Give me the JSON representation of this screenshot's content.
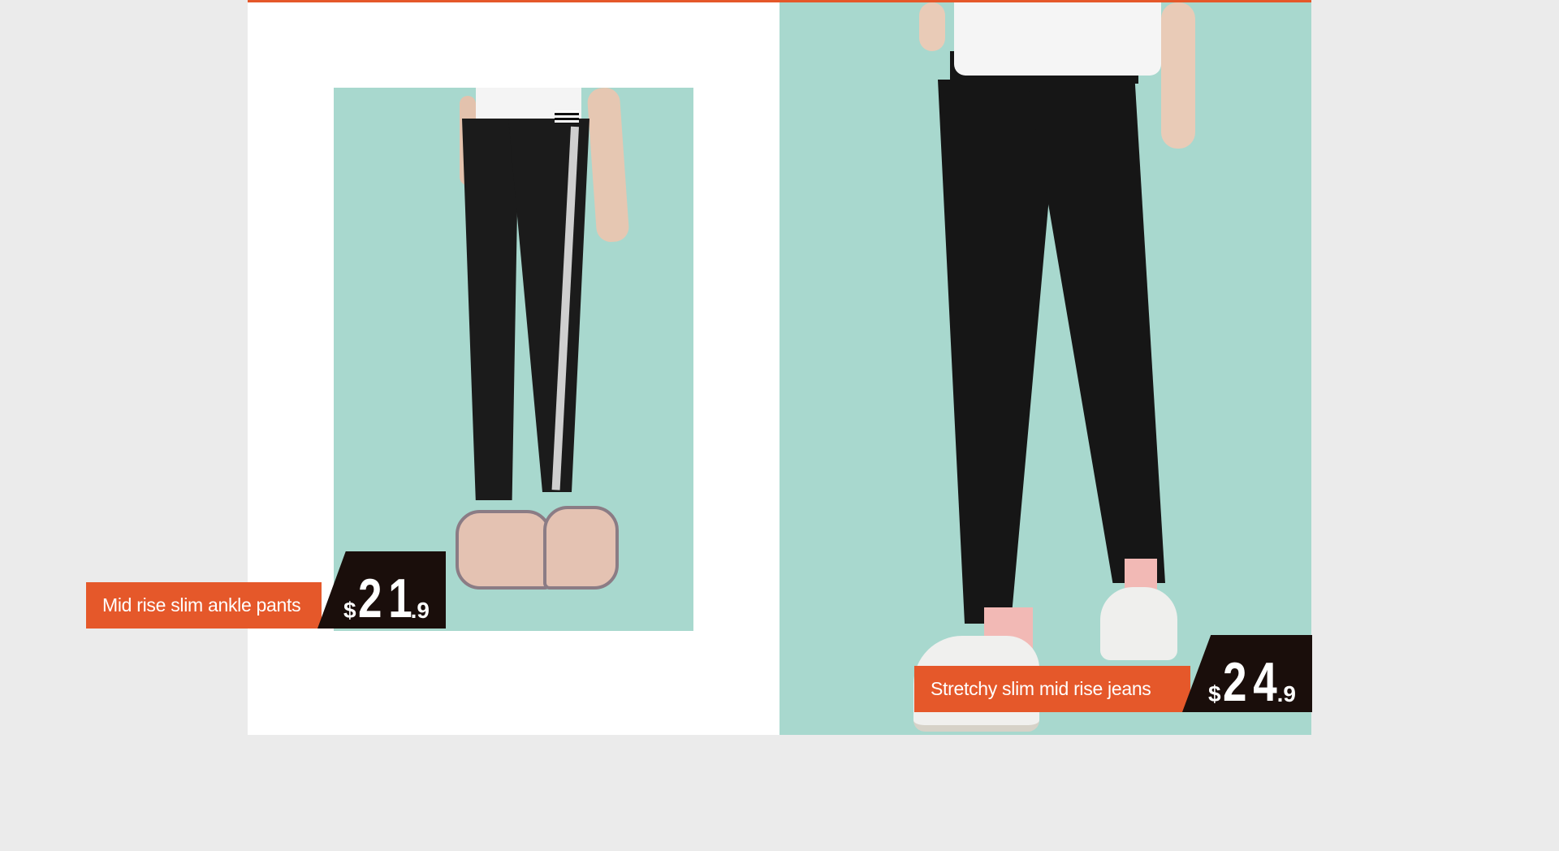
{
  "colors": {
    "accent": "#e5582a",
    "mint_background": "#a8d8ce",
    "price_box": "#1a0e0b",
    "page_background": "#ebebeb"
  },
  "products": [
    {
      "name": "Mid rise slim ankle pants",
      "currency": "$",
      "price_integer": "21",
      "price_decimal": ".9"
    },
    {
      "name": "Stretchy slim mid rise jeans",
      "currency": "$",
      "price_integer": "24",
      "price_decimal": ".9"
    }
  ]
}
